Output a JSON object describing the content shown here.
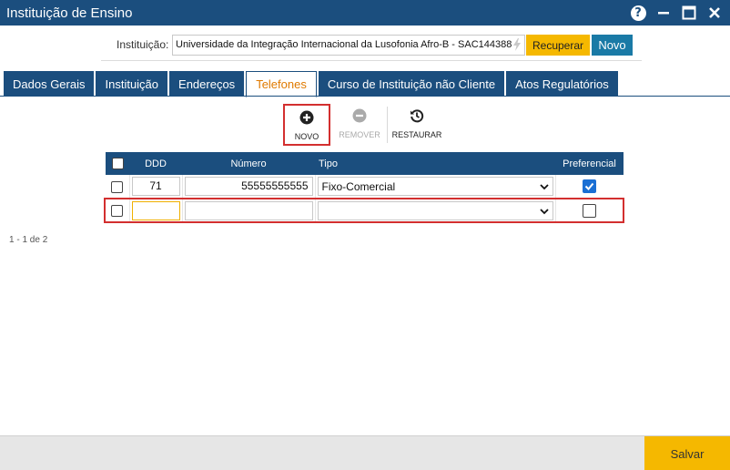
{
  "window": {
    "title": "Instituição de Ensino"
  },
  "institution": {
    "label": "Instituição:",
    "value": "Universidade da Integração Internacional da Lusofonia Afro-B - SAC144388",
    "recuperar_label": "Recuperar",
    "novo_label": "Novo"
  },
  "tabs": [
    {
      "label": "Dados Gerais",
      "active": false
    },
    {
      "label": "Instituição",
      "active": false
    },
    {
      "label": "Endereços",
      "active": false
    },
    {
      "label": "Telefones",
      "active": true
    },
    {
      "label": "Curso de Instituição não Cliente",
      "active": false
    },
    {
      "label": "Atos Regulatórios",
      "active": false
    }
  ],
  "toolbar": {
    "novo_label": "NOVO",
    "remover_label": "REMOVER",
    "restaurar_label": "RESTAURAR"
  },
  "grid": {
    "columns": {
      "ddd": "DDD",
      "numero": "Número",
      "tipo": "Tipo",
      "preferencial": "Preferencial"
    },
    "rows": [
      {
        "ddd": "71",
        "numero": "55555555555",
        "tipo": "Fixo-Comercial",
        "preferencial": true
      },
      {
        "ddd": "",
        "numero": "",
        "tipo": "",
        "preferencial": false
      }
    ]
  },
  "pager": {
    "text": "1 - 1 de 2"
  },
  "footer": {
    "salvar_label": "Salvar"
  },
  "colors": {
    "header_blue": "#1b4e7e",
    "accent_yellow": "#f5b800",
    "active_tab_orange": "#e07a00",
    "highlight_red": "#d32f2f",
    "checkbox_blue": "#1a6fd4"
  }
}
